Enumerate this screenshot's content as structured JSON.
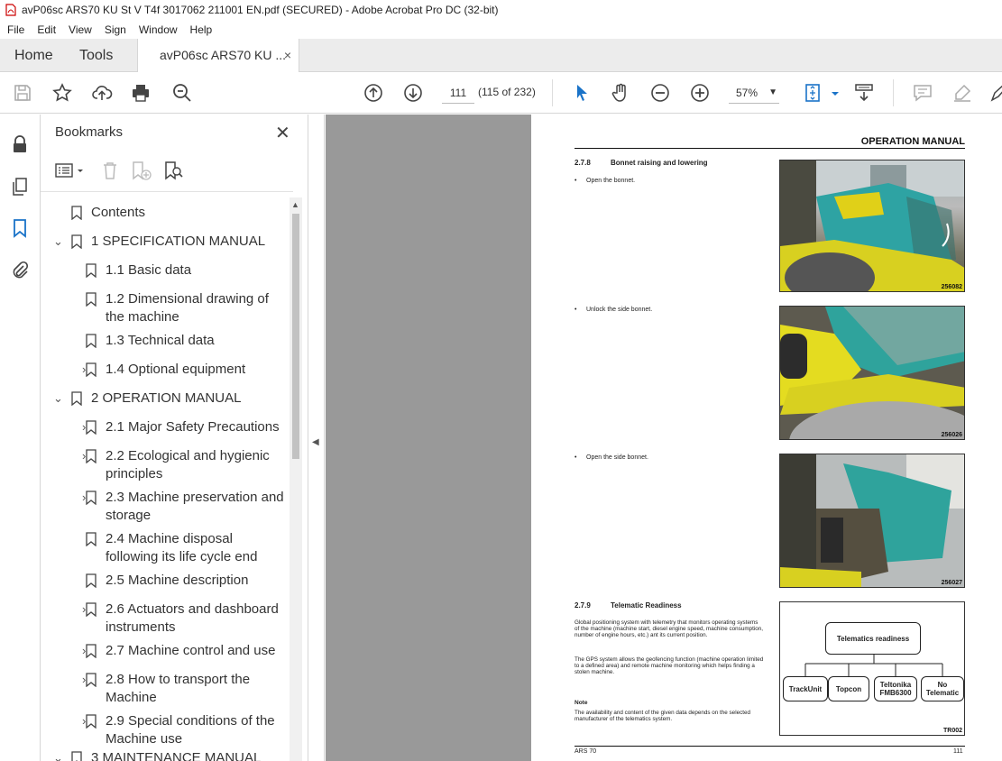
{
  "window": {
    "title": "avP06sc ARS70 KU St V T4f 3017062 211001 EN.pdf (SECURED) - Adobe Acrobat Pro DC (32-bit)"
  },
  "menu": [
    "File",
    "Edit",
    "View",
    "Sign",
    "Window",
    "Help"
  ],
  "tabs": {
    "home": "Home",
    "tools": "Tools",
    "document": "avP06sc ARS70 KU ...",
    "close": "×"
  },
  "toolbar": {
    "page_number": "111",
    "page_count": "(115 of 232)",
    "zoom": "57%"
  },
  "bookmarks": {
    "title": "Bookmarks",
    "close": "✕",
    "items": [
      {
        "label": "Contents"
      },
      {
        "label": "1 SPECIFICATION MANUAL"
      },
      {
        "label": "1.1 Basic data"
      },
      {
        "label": "1.2 Dimensional drawing of",
        "label2": "the machine"
      },
      {
        "label": "1.3 Technical data"
      },
      {
        "label": "1.4 Optional equipment"
      },
      {
        "label": "2 OPERATION MANUAL"
      },
      {
        "label": "2.1 Major Safety Precautions"
      },
      {
        "label": "2.2 Ecological and hygienic",
        "label2": "principles"
      },
      {
        "label": "2.3 Machine preservation and",
        "label2": "storage"
      },
      {
        "label": "2.4 Machine disposal",
        "label2": "following its life cycle end"
      },
      {
        "label": "2.5 Machine description"
      },
      {
        "label": "2.6 Actuators and dashboard",
        "label2": "instruments"
      },
      {
        "label": "2.7 Machine control and use"
      },
      {
        "label": "2.8 How to transport the",
        "label2": "Machine"
      },
      {
        "label": "2.9 Special conditions of the",
        "label2": "Machine use"
      },
      {
        "label": "3 MAINTENANCE MANUAL"
      }
    ]
  },
  "page": {
    "header": "OPERATION MANUAL",
    "sec1_num": "2.7.8",
    "sec1_title": "Bonnet raising and lowering",
    "step1": "Open the bonnet.",
    "step2": "Unlock the side bonnet.",
    "step3": "Open the side bonnet.",
    "photo1_code": "256082",
    "photo2_code": "256026",
    "photo3_code": "256027",
    "sec2_num": "2.7.9",
    "sec2_title": "Telematic Readiness",
    "para1": "Global positioning system with telemetry that monitors operating systems of the machine (machine start, diesel engine speed, machine consumption, number of engine hours, etc.) ant its current position.",
    "para2": "The GPS system allows the geofencing function (machine operation limited to a defined area) and remote machine monitoring which helps finding a stolen machine.",
    "note_title": "Note",
    "note_text": "The availability and content of the given data depends on the selected manufacturer of the telematics system.",
    "diagram": {
      "root": "Telematics readiness",
      "c1": "TrackUnit",
      "c2": "Topcon",
      "c3": "Teltonika FMB6300",
      "c4": "No Telematic",
      "code": "TR002"
    },
    "footer_left": "ARS 70",
    "footer_right": "111"
  }
}
